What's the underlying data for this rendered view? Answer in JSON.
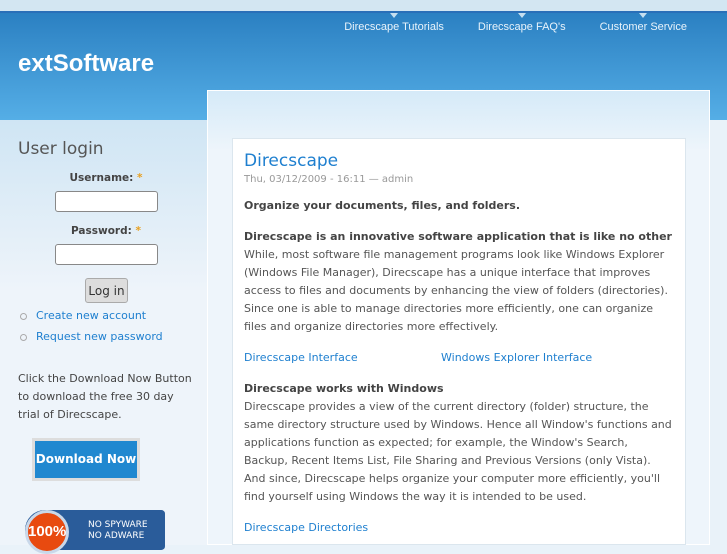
{
  "nav": [
    "Direcscape Tutorials",
    "Direcscape FAQ's",
    "Customer Service"
  ],
  "logo": "extSoftware",
  "login": {
    "title": "User login",
    "username_label": "Username:",
    "password_label": "Password:",
    "required": "*",
    "button": "Log in",
    "links": [
      "Create new account",
      "Request new password"
    ]
  },
  "promo": {
    "text": "Click the Download Now Button to download the free 30 day trial of Direcscape.",
    "button": "Download Now",
    "badge_pct": "100%",
    "badge_lines": [
      "NO SPYWARE",
      "NO ADWARE"
    ]
  },
  "article": {
    "title": "Direcscape",
    "meta": "Thu, 03/12/2009 - 16:11 — admin",
    "lead": "Organize your documents, files, and folders.",
    "h1": "Direcscape is an innovative software application that is like no other",
    "p1": "While, most software file management programs look like Windows Explorer (Windows File Manager), Direcscape has a unique interface that improves access to files and documents by enhancing the view of folders (directories). Since one is able to manage directories more efficiently, one can organize files and organize directories more effectively.",
    "links": [
      "Direcscape Interface",
      "Windows Explorer Interface"
    ],
    "h2": "Direcscape works with Windows",
    "p2": "Direcscape provides a view of the current directory (folder) structure, the same directory structure used by Windows. Hence all Window's functions and applications function as expected; for example, the Window's Search, Backup, Recent Items List, File Sharing and Previous Versions (only Vista). And since, Direcscape helps organize your computer more efficiently, you'll find yourself using Windows the way it is intended to be used.",
    "link3": "Direcscape Directories"
  }
}
